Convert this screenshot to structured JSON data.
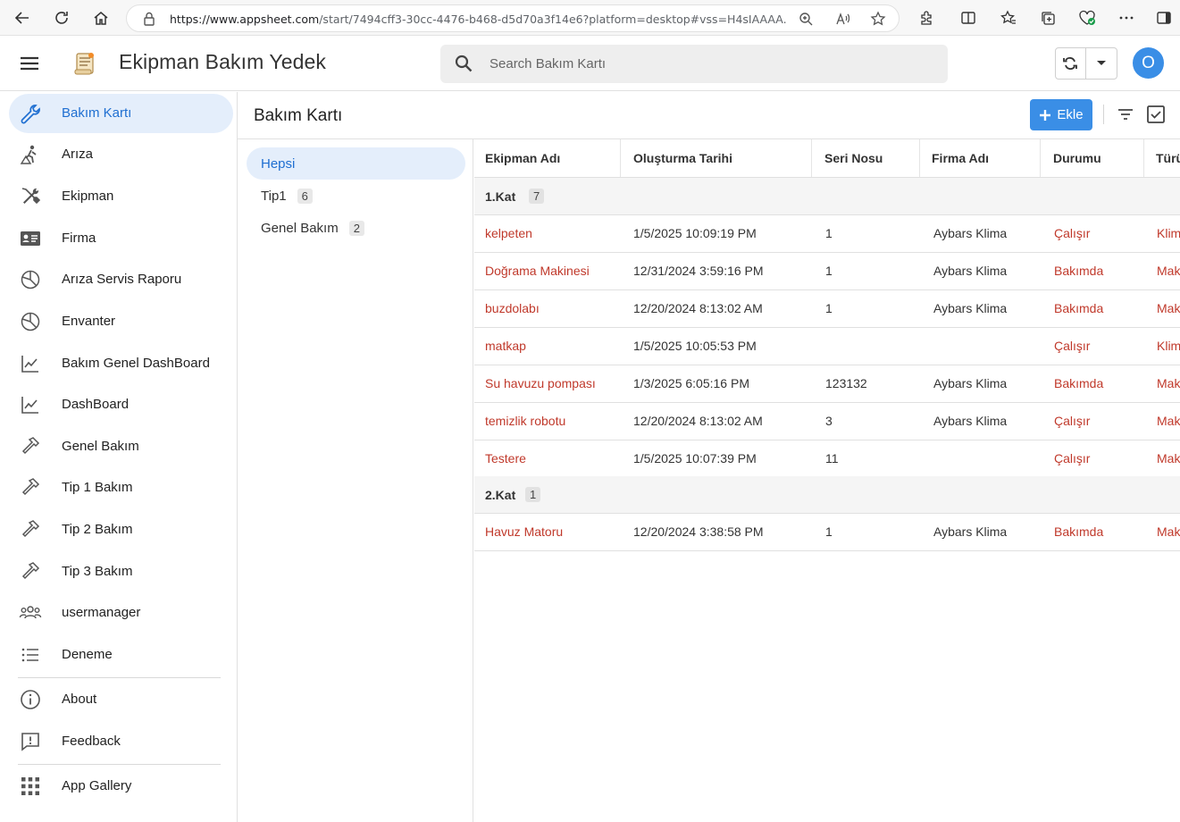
{
  "browser": {
    "url_host": "https://www.appsheet.com",
    "url_path": "/start/7494cff3-30cc-4476-b468-d5d70a3f14e6?platform=desktop#vss=H4sIAAAA..."
  },
  "header": {
    "app_title": "Ekipman Bakım Yedek",
    "search_placeholder": "Search Bakım Kartı",
    "avatar_letter": "O"
  },
  "sidebar": {
    "items": [
      {
        "label": "Bakım Kartı",
        "icon": "wrench-icon"
      },
      {
        "label": "Arıza",
        "icon": "hazard-worker-icon"
      },
      {
        "label": "Ekipman",
        "icon": "tools-icon"
      },
      {
        "label": "Firma",
        "icon": "id-card-icon"
      },
      {
        "label": "Arıza Servis Raporu",
        "icon": "pie-chart-icon"
      },
      {
        "label": "Envanter",
        "icon": "pie-chart-icon"
      },
      {
        "label": "Bakım Genel DashBoard",
        "icon": "line-chart-icon"
      },
      {
        "label": "DashBoard",
        "icon": "line-chart-icon"
      },
      {
        "label": "Genel Bakım",
        "icon": "hammer-icon"
      },
      {
        "label": "Tip 1 Bakım",
        "icon": "hammer-icon"
      },
      {
        "label": "Tip 2 Bakım",
        "icon": "hammer-icon"
      },
      {
        "label": "Tip 3 Bakım",
        "icon": "hammer-icon"
      },
      {
        "label": "usermanager",
        "icon": "users-icon"
      },
      {
        "label": "Deneme",
        "icon": "list-icon"
      }
    ],
    "about": "About",
    "feedback": "Feedback",
    "gallery": "App Gallery"
  },
  "main": {
    "title": "Bakım Kartı",
    "add_label": "Ekle",
    "groups": [
      {
        "label": "Hepsi",
        "count": ""
      },
      {
        "label": "Tip1",
        "count": "6"
      },
      {
        "label": "Genel Bakım",
        "count": "2"
      }
    ],
    "columns": [
      "Ekipman Adı",
      "Oluşturma Tarihi",
      "Seri Nosu",
      "Firma Adı",
      "Durumu",
      "Türü"
    ],
    "table_groups": [
      {
        "label": "1.Kat",
        "count": "7",
        "rows": [
          [
            "kelpeten",
            "1/5/2025 10:09:19 PM",
            "1",
            "Aybars Klima",
            "Çalışır",
            "Klima"
          ],
          [
            "Doğrama Makinesi",
            "12/31/2024 3:59:16 PM",
            "1",
            "Aybars Klima",
            "Bakımda",
            "Makine"
          ],
          [
            "buzdolabı",
            "12/20/2024 8:13:02 AM",
            "1",
            "Aybars Klima",
            "Bakımda",
            "Makine"
          ],
          [
            "matkap",
            "1/5/2025 10:05:53 PM",
            "",
            "",
            "Çalışır",
            "Klima"
          ],
          [
            "Su havuzu pompası",
            "1/3/2025 6:05:16 PM",
            "123132",
            "Aybars Klima",
            "Bakımda",
            "Makine"
          ],
          [
            "temizlik robotu",
            "12/20/2024 8:13:02 AM",
            "3",
            "Aybars Klima",
            "Çalışır",
            "Makine"
          ],
          [
            "Testere",
            "1/5/2025 10:07:39 PM",
            "11",
            "",
            "Çalışır",
            "Makine"
          ]
        ]
      },
      {
        "label": "2.Kat",
        "count": "1",
        "rows": [
          [
            "Havuz Matoru",
            "12/20/2024 3:38:58 PM",
            "1",
            "Aybars Klima",
            "Bakımda",
            "Makine"
          ]
        ]
      }
    ]
  },
  "colors": {
    "accent": "#3a8ee6",
    "link": "#c0392b",
    "active_bg": "#e4eefb"
  }
}
